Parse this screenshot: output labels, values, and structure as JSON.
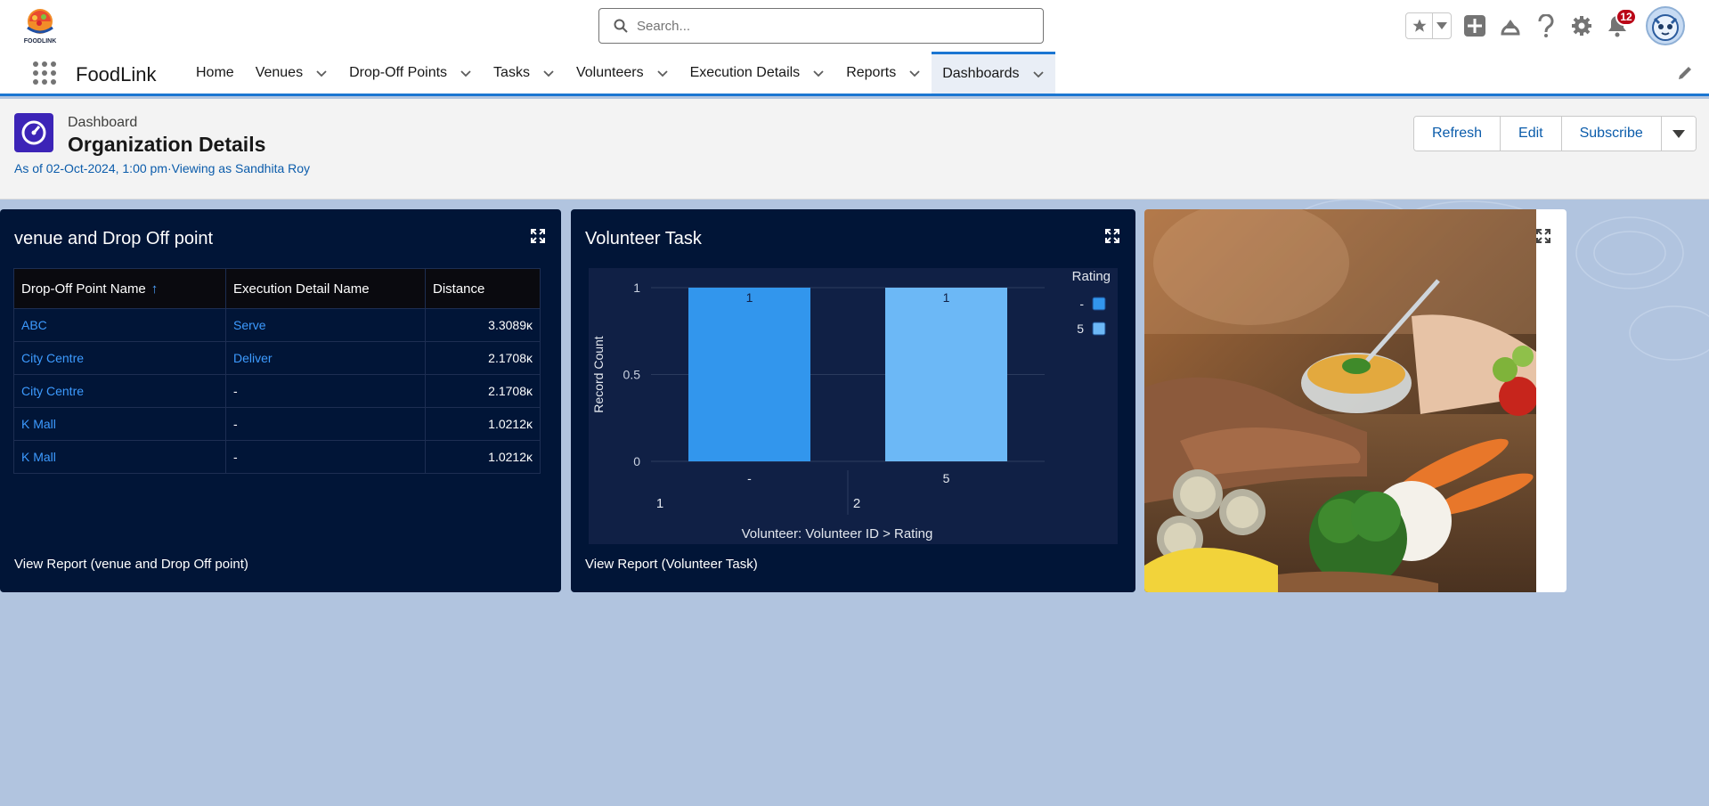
{
  "header": {
    "logo_text": "FOODLINK",
    "search_placeholder": "Search...",
    "notification_count": "12"
  },
  "nav": {
    "app_name": "FoodLink",
    "items": [
      {
        "label": "Home",
        "has_menu": false
      },
      {
        "label": "Venues",
        "has_menu": true
      },
      {
        "label": "Drop-Off Points",
        "has_menu": true
      },
      {
        "label": "Tasks",
        "has_menu": true
      },
      {
        "label": "Volunteers",
        "has_menu": true
      },
      {
        "label": "Execution Details",
        "has_menu": true
      },
      {
        "label": "Reports",
        "has_menu": true
      },
      {
        "label": "Dashboards",
        "has_menu": true,
        "active": true
      }
    ]
  },
  "page": {
    "kicker": "Dashboard",
    "title": "Organization Details",
    "meta": "As of 02-Oct-2024, 1:00 pm·Viewing as Sandhita Roy",
    "buttons": {
      "refresh": "Refresh",
      "edit": "Edit",
      "subscribe": "Subscribe"
    }
  },
  "widget_table": {
    "title": "venue and Drop Off point",
    "columns": [
      "Drop-Off Point Name",
      "Execution Detail Name",
      "Distance"
    ],
    "sort_indicator": "↑",
    "rows": [
      [
        "ABC",
        "Serve",
        "3.3089ĸ"
      ],
      [
        "City Centre",
        "Deliver",
        "2.1708ĸ"
      ],
      [
        "City Centre",
        "-",
        "2.1708ĸ"
      ],
      [
        "K Mall",
        "-",
        "1.0212ĸ"
      ],
      [
        "K Mall",
        "-",
        "1.0212ĸ"
      ]
    ],
    "footer": "View Report (venue and Drop Off point)"
  },
  "widget_chart": {
    "title": "Volunteer Task",
    "footer": "View Report (Volunteer Task)"
  },
  "chart_data": {
    "type": "bar",
    "groups": [
      "1",
      "2"
    ],
    "categories": [
      "-",
      "5"
    ],
    "series": [
      {
        "name": "-",
        "values": [
          1,
          0
        ],
        "color": "#3296ed"
      },
      {
        "name": "5",
        "values": [
          0,
          1
        ],
        "color": "#6cb8f6"
      }
    ],
    "data_labels": [
      "1",
      "1"
    ],
    "xlabel": "Volunteer: Volunteer ID  >  Rating",
    "ylabel": "Record Count",
    "yticks": [
      "0",
      "0.5",
      "1"
    ],
    "ylim": [
      0,
      1
    ],
    "legend_title": "Rating",
    "legend": [
      "-",
      "5"
    ],
    "legend_position": "top-right",
    "grid": true
  },
  "colors": {
    "accent": "#1b76d2",
    "widget_bg": "#011537",
    "link": "#0b5cab"
  }
}
